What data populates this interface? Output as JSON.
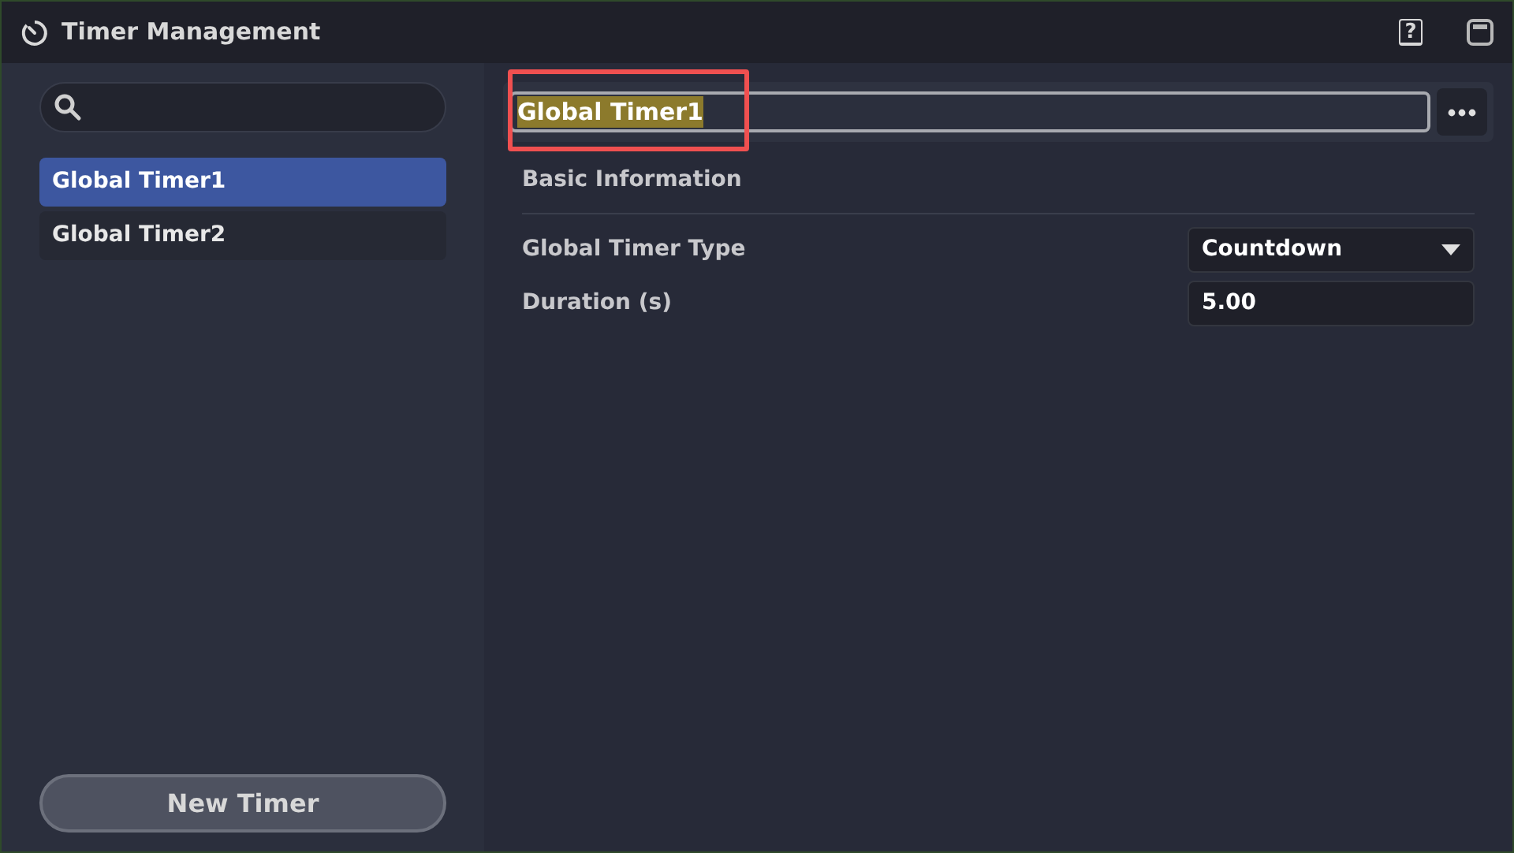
{
  "window": {
    "title": "Timer Management",
    "help_glyph": "?"
  },
  "sidebar": {
    "items": [
      {
        "label": "Global Timer1",
        "selected": true
      },
      {
        "label": "Global Timer2",
        "selected": false
      }
    ],
    "new_button": "New Timer"
  },
  "editor": {
    "name_field": {
      "value": "Global Timer1",
      "text_selected": true,
      "highlighted": true
    },
    "section": "Basic Information",
    "fields": [
      {
        "kind": "dropdown",
        "label": "Global Timer Type",
        "value": "Countdown"
      },
      {
        "kind": "number",
        "label": "Duration (s)",
        "value": "5.00"
      }
    ]
  }
}
